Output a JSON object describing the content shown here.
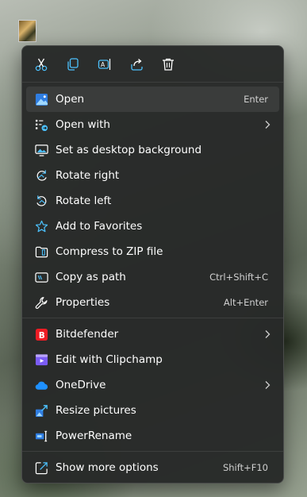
{
  "quick_actions": [
    {
      "name": "cut-icon",
      "icon": "scissors"
    },
    {
      "name": "copy-icon",
      "icon": "copy"
    },
    {
      "name": "rename-icon",
      "icon": "rename"
    },
    {
      "name": "share-icon",
      "icon": "share"
    },
    {
      "name": "delete-icon",
      "icon": "trash"
    }
  ],
  "menu": {
    "open": {
      "label": "Open",
      "shortcut": "Enter"
    },
    "open_with": {
      "label": "Open with"
    },
    "set_desktop_bg": {
      "label": "Set as desktop background"
    },
    "rotate_right": {
      "label": "Rotate right"
    },
    "rotate_left": {
      "label": "Rotate left"
    },
    "add_favorites": {
      "label": "Add to Favorites"
    },
    "compress_zip": {
      "label": "Compress to ZIP file"
    },
    "copy_as_path": {
      "label": "Copy as path",
      "shortcut": "Ctrl+Shift+C"
    },
    "properties": {
      "label": "Properties",
      "shortcut": "Alt+Enter"
    },
    "bitdefender": {
      "label": "Bitdefender"
    },
    "clipchamp": {
      "label": "Edit with Clipchamp"
    },
    "onedrive": {
      "label": "OneDrive"
    },
    "resize_pictures": {
      "label": "Resize pictures"
    },
    "powerrename": {
      "label": "PowerRename"
    },
    "show_more": {
      "label": "Show more options",
      "shortcut": "Shift+F10"
    }
  },
  "colors": {
    "accent": "#4cc2ff",
    "menu_bg": "#272928",
    "bitdefender": "#ed1c24",
    "clipchamp": "#7b5cf5",
    "onedrive": "#1e90ff"
  }
}
